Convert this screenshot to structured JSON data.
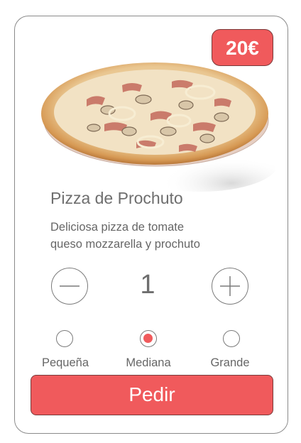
{
  "product": {
    "price": "20€",
    "title": "Pizza de Prochuto",
    "description_line1": "Deliciosa pizza de tomate",
    "description_line2": "queso mozzarella y prochuto"
  },
  "quantity": {
    "value": "1"
  },
  "sizes": {
    "options": [
      {
        "label": "Pequeña",
        "selected": false
      },
      {
        "label": "Mediana",
        "selected": true
      },
      {
        "label": "Grande",
        "selected": false
      }
    ]
  },
  "order_button": {
    "label": "Pedir"
  },
  "colors": {
    "accent": "#f05a5c",
    "border": "#8a8a8a",
    "text": "#6b6b6b"
  },
  "icons": {
    "minus": "minus-icon",
    "plus": "plus-icon"
  }
}
